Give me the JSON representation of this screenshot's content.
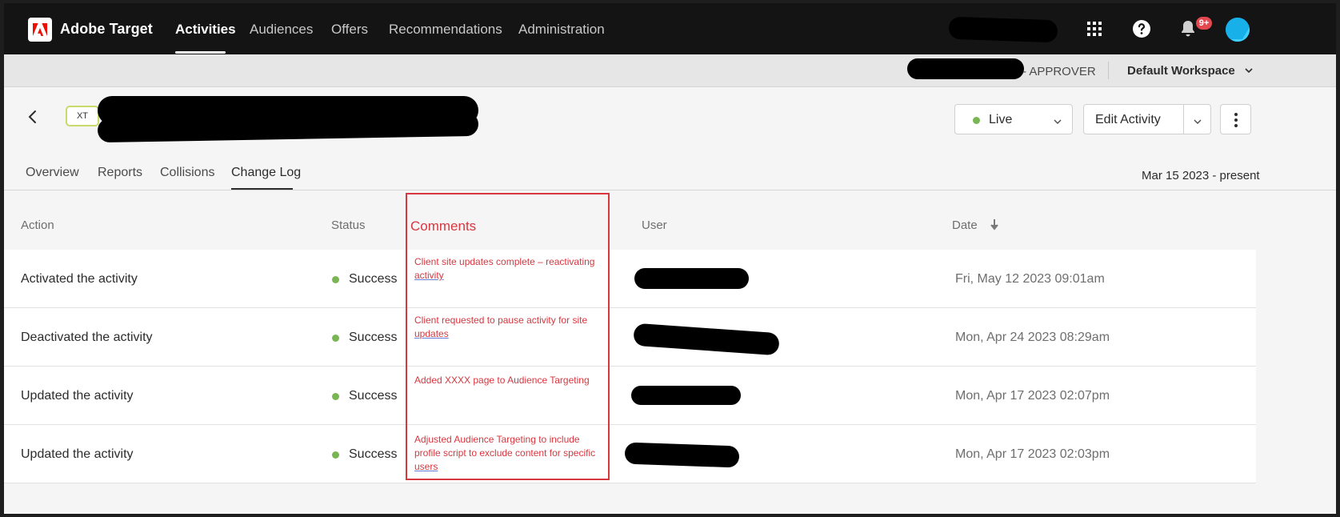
{
  "app": {
    "brand": "Adobe Target",
    "nav": [
      "Activities",
      "Audiences",
      "Offers",
      "Recommendations",
      "Administration"
    ],
    "active_nav": "Activities",
    "notifications_badge": "9+"
  },
  "workspace": {
    "role": "- APPROVER",
    "name": "Default Workspace"
  },
  "activity": {
    "type_tag": "XT",
    "status_label": "Live",
    "edit_label": "Edit Activity"
  },
  "tabs": [
    "Overview",
    "Reports",
    "Collisions",
    "Change Log"
  ],
  "active_tab": "Change Log",
  "date_range": "Mar 15 2023 - present",
  "table": {
    "headers": {
      "action": "Action",
      "status": "Status",
      "comments": "Comments",
      "user": "User",
      "date": "Date"
    },
    "rows": [
      {
        "action": "Activated the activity",
        "status": "Success",
        "comment_lines": [
          "Client site updates complete – reactivating",
          "activity"
        ],
        "date": "Fri, May 12 2023 09:01am"
      },
      {
        "action": "Deactivated the activity",
        "status": "Success",
        "comment_lines": [
          "Client requested to pause activity for site",
          "updates"
        ],
        "date": "Mon, Apr 24 2023 08:29am"
      },
      {
        "action": "Updated the activity",
        "status": "Success",
        "comment_lines": [
          "Added XXXX page to Audience Targeting"
        ],
        "date": "Mon, Apr 17 2023 02:07pm"
      },
      {
        "action": "Updated the activity",
        "status": "Success",
        "comment_lines": [
          "Adjusted Audience Targeting to include",
          "profile script to exclude content for specific",
          "users"
        ],
        "date": "Mon, Apr 17 2023 02:03pm"
      }
    ]
  },
  "colors": {
    "nav_bg": "#141414",
    "success": "#79b553",
    "annotation_red": "#d7373f",
    "adobe_red": "#eb1000"
  }
}
